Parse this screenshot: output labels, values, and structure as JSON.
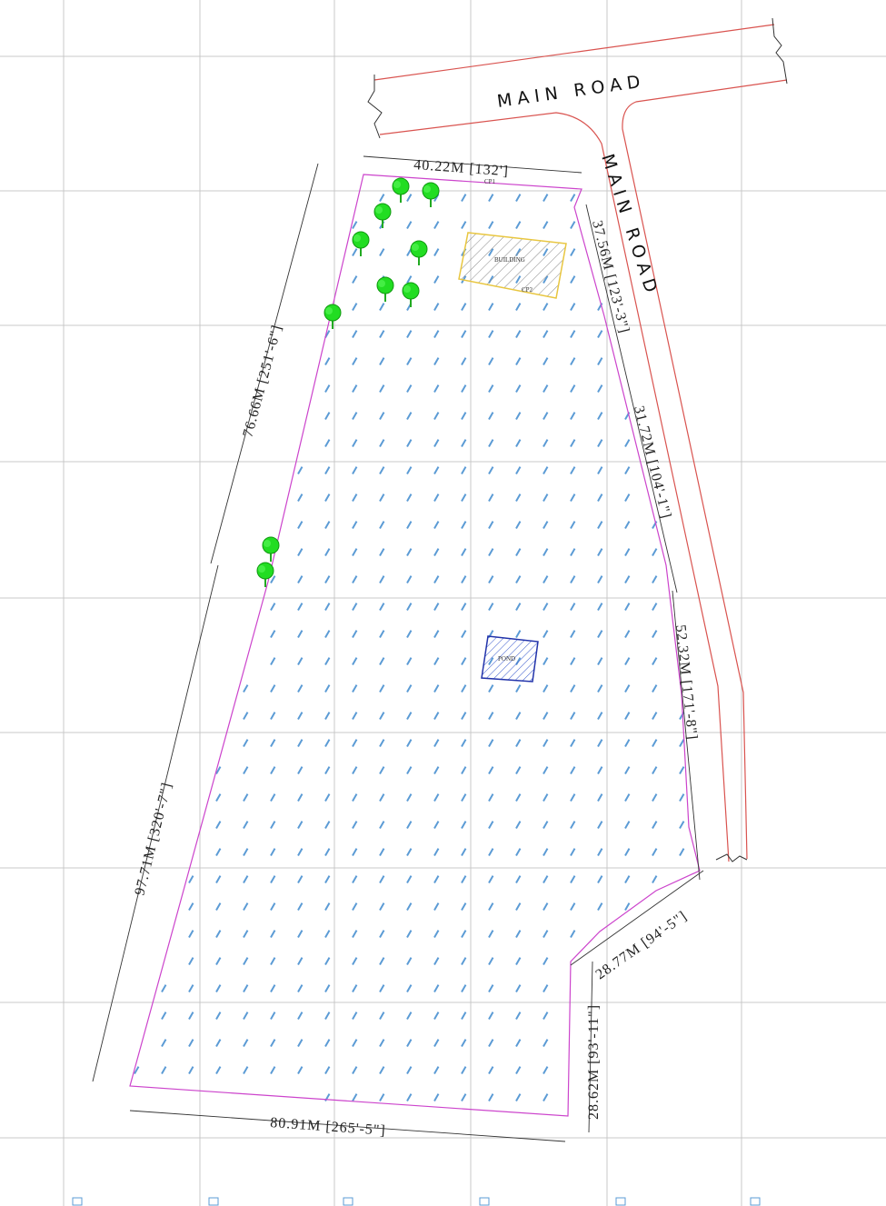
{
  "labels": {
    "main_road_horizontal": "MAIN ROAD",
    "main_road_vertical": "MAIN ROAD",
    "building": "BUILDING",
    "pond": "POND",
    "cp1": "CP1",
    "cp2": "CP2"
  },
  "dimensions": {
    "top": "40.22M  [132']",
    "left_upper": "76.66M  [251'-6\"]",
    "left_lower": "97.71M  [320'-7\"]",
    "bottom": "80.91M  [265'-5\"]",
    "right_1": "37.56M  [123'-3\"]",
    "right_2": "31.72M  [104'-1\"]",
    "right_3": "52.32M  [171'-8\"]",
    "right_4": "28.77M  [94'-5\"]",
    "right_5": "28.62M  [93'-11\"]"
  },
  "colors": {
    "boundary": "#cc44cc",
    "road": "#d9534f",
    "grid": "#c8c8c8",
    "points": "#2a6fd6",
    "tree": "#22dd22",
    "building_outline": "#e8c640",
    "pond_outline": "#2233aa"
  },
  "icons": {
    "tree": "tree-icon",
    "survey_point": "survey-point-icon"
  }
}
